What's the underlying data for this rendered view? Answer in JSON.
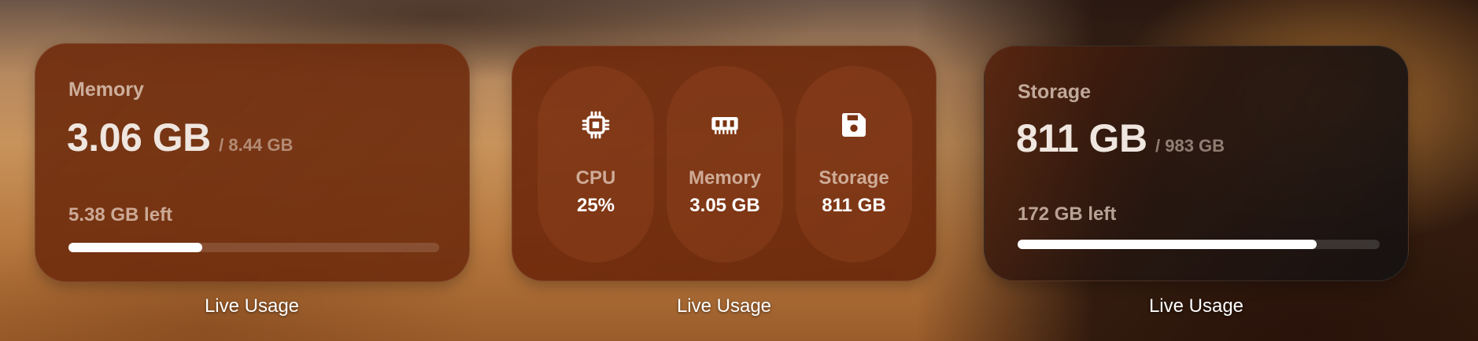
{
  "memory_card": {
    "label": "Memory",
    "used": "3.06 GB",
    "total": "/ 8.44 GB",
    "left": "5.38 GB left",
    "usage_fraction": 0.36
  },
  "status_card": {
    "items": [
      {
        "icon": "cpu-icon",
        "label": "CPU",
        "value": "25%"
      },
      {
        "icon": "memory-chip-icon",
        "label": "Memory",
        "value": "3.05 GB"
      },
      {
        "icon": "floppy-disk-icon",
        "label": "Storage",
        "value": "811 GB"
      }
    ]
  },
  "storage_card": {
    "label": "Storage",
    "used": "811 GB",
    "total": "/ 983 GB",
    "left": "172 GB left",
    "usage_fraction": 0.825
  },
  "captions": [
    "Live Usage",
    "Live Usage",
    "Live Usage"
  ]
}
